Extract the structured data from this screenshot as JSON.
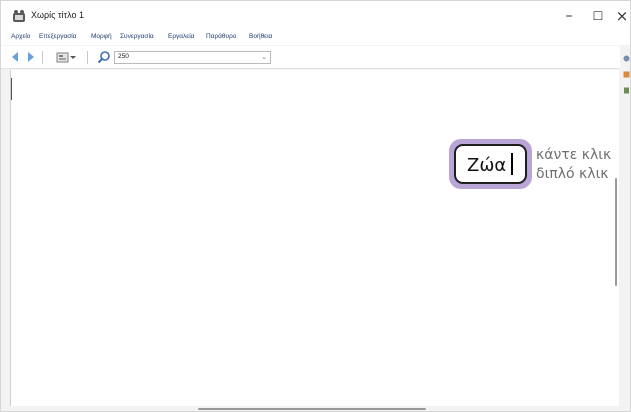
{
  "window": {
    "title": "Χωρίς τίτλο 1",
    "controls": {
      "minimize": "–",
      "maximize": "☐",
      "close": "×"
    }
  },
  "menu": {
    "items": [
      "Αρχείο",
      "Επεξεργασία",
      "Μορφή",
      "Συνεργασία",
      "Εργαλεία",
      "Παράθυρο",
      "Βοήθεια"
    ]
  },
  "toolbar": {
    "zoom_value": "250",
    "icons": [
      "back-arrow-icon",
      "forward-arrow-icon",
      "map-view-icon",
      "dropdown-caret-icon",
      "zoom-magnifier-icon"
    ]
  },
  "canvas": {
    "node_text": "Ζώα",
    "hint_line_1": "κάντε κλικ κ",
    "hint_line_2": "διπλό κλικ '"
  },
  "colors": {
    "node_border": "#b9a6d6",
    "node_outline": "#1e1e1e",
    "hint_text": "#707070",
    "menu_text": "#1f3a6e"
  }
}
